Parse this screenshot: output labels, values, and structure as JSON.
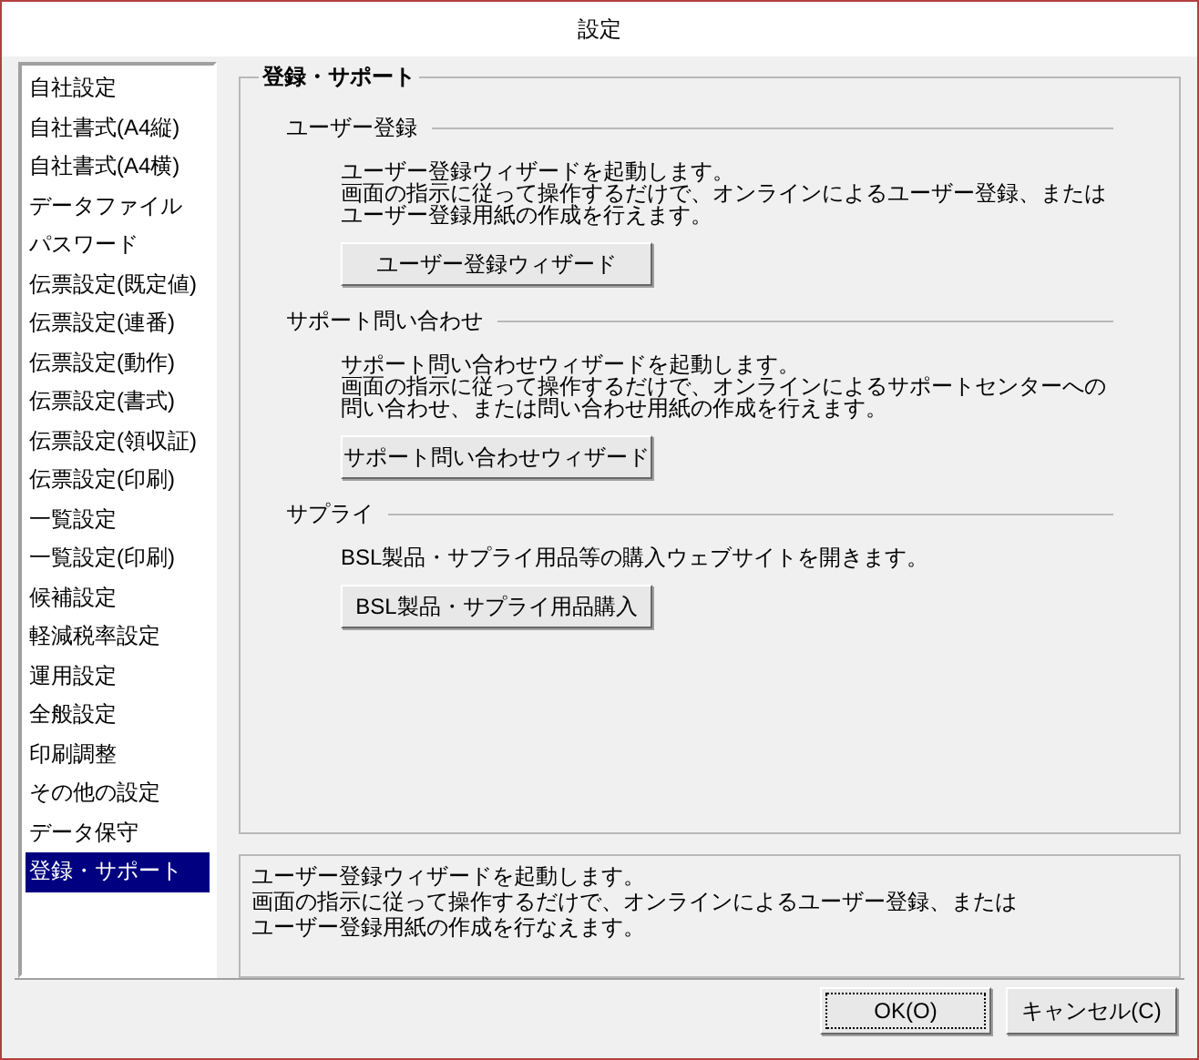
{
  "window": {
    "title": "設定"
  },
  "sidebar": {
    "items": [
      {
        "label": "自社設定",
        "selected": false
      },
      {
        "label": "自社書式(A4縦)",
        "selected": false
      },
      {
        "label": "自社書式(A4横)",
        "selected": false
      },
      {
        "label": "データファイル",
        "selected": false
      },
      {
        "label": "パスワード",
        "selected": false
      },
      {
        "label": "伝票設定(既定値)",
        "selected": false
      },
      {
        "label": "伝票設定(連番)",
        "selected": false
      },
      {
        "label": "伝票設定(動作)",
        "selected": false
      },
      {
        "label": "伝票設定(書式)",
        "selected": false
      },
      {
        "label": "伝票設定(領収証)",
        "selected": false
      },
      {
        "label": "伝票設定(印刷)",
        "selected": false
      },
      {
        "label": "一覧設定",
        "selected": false
      },
      {
        "label": "一覧設定(印刷)",
        "selected": false
      },
      {
        "label": "候補設定",
        "selected": false
      },
      {
        "label": "軽減税率設定",
        "selected": false
      },
      {
        "label": "運用設定",
        "selected": false
      },
      {
        "label": "全般設定",
        "selected": false
      },
      {
        "label": "印刷調整",
        "selected": false
      },
      {
        "label": "その他の設定",
        "selected": false
      },
      {
        "label": "データ保守",
        "selected": false
      },
      {
        "label": "登録・サポート",
        "selected": true
      }
    ]
  },
  "panel": {
    "title": "登録・サポート",
    "sections": [
      {
        "heading": "ユーザー登録",
        "description": [
          "ユーザー登録ウィザードを起動します。",
          "画面の指示に従って操作するだけで、オンラインによるユーザー登録、または",
          "ユーザー登録用紙の作成を行えます。"
        ],
        "button": "ユーザー登録ウィザード"
      },
      {
        "heading": "サポート問い合わせ",
        "description": [
          "サポート問い合わせウィザードを起動します。",
          "画面の指示に従って操作するだけで、オンラインによるサポートセンターへの",
          "問い合わせ、または問い合わせ用紙の作成を行えます。"
        ],
        "button": "サポート問い合わせウィザード"
      },
      {
        "heading": "サプライ",
        "description": [
          "BSL製品・サプライ用品等の購入ウェブサイトを開きます。"
        ],
        "button": "BSL製品・サプライ用品購入"
      }
    ]
  },
  "help_text": [
    "ユーザー登録ウィザードを起動します。",
    "画面の指示に従って操作するだけで、オンラインによるユーザー登録、または",
    "ユーザー登録用紙の作成を行なえます。"
  ],
  "buttons": [
    {
      "label": "OK(O)",
      "focused": true
    },
    {
      "label": "キャンセル(C)",
      "focused": false
    }
  ]
}
